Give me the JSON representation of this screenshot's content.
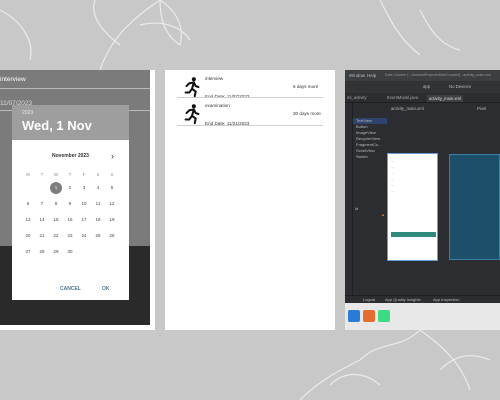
{
  "colors": {
    "background": "#c8c8c8",
    "picker_header": "#9e9e9e",
    "picker_selected": "#7d7d7d",
    "picker_button": "#4b7690",
    "ide_dark": "#2b2d30",
    "ide_button": "#2e8b7b"
  },
  "datepicker_screen": {
    "field_1": "interview",
    "field_2": "11/07/2023",
    "dialog": {
      "year": "2023",
      "selected_date": "Wed, 1 Nov",
      "month": "November 2023",
      "next_icon": "chevron-right-icon",
      "weekday_labels": [
        "M",
        "T",
        "W",
        "T",
        "F",
        "S",
        "S"
      ],
      "weeks": [
        [
          "",
          "",
          "1",
          "2",
          "3",
          "4",
          "5"
        ],
        [
          "6",
          "7",
          "8",
          "9",
          "10",
          "11",
          "12"
        ],
        [
          "13",
          "14",
          "15",
          "16",
          "17",
          "18",
          "19"
        ],
        [
          "20",
          "21",
          "22",
          "23",
          "24",
          "25",
          "26"
        ],
        [
          "27",
          "28",
          "29",
          "30",
          "",
          "",
          ""
        ]
      ],
      "selected_day": "1",
      "cancel_label": "CANCEL",
      "ok_label": "OK"
    }
  },
  "list_screen": {
    "items": [
      {
        "icon": "running-person-icon",
        "title": "interview",
        "remaining": "6 days more",
        "end_date": "End Date: 11/07/2023"
      },
      {
        "icon": "running-person-icon",
        "title": "examination",
        "remaining": "30 days more",
        "end_date": "End Date: 11/21/2023"
      }
    ]
  },
  "ide_screen": {
    "menu": [
      "Window",
      "Help"
    ],
    "window_title": "Date Counter [...\\AndroidProjects\\DateCounter] - activity_main.xml",
    "toolbar": {
      "run_config": "app",
      "device": "No Devices"
    },
    "tabs": [
      "ml_activity",
      "EventModel.java",
      "activity_main.xml"
    ],
    "design_tab": "activity_main.xml",
    "palette": [
      "TextView",
      "Button",
      "ImageView",
      "RecyclerView",
      "FragmentCo...",
      "ScrollView",
      "Switch"
    ],
    "palette_selected": "TextView",
    "attributes_label": "id",
    "bottom_bar": [
      "Logcat",
      "App Quality Insights",
      "App Inspection"
    ],
    "pixel_label": "Pixel"
  }
}
